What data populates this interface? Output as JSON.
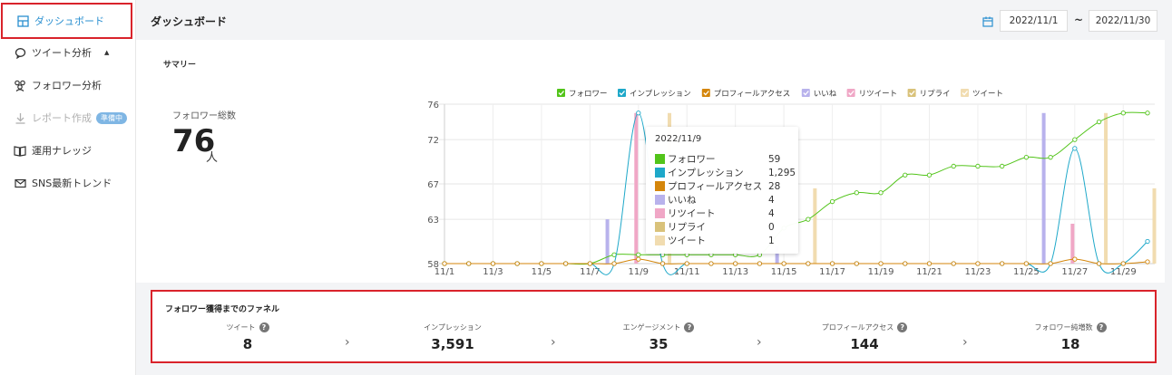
{
  "sidebar": {
    "items": [
      {
        "label": "ダッシュボード",
        "icon": "dashboard-icon"
      },
      {
        "label": "ツイート分析",
        "icon": "speech-bubble-icon"
      },
      {
        "label": "フォロワー分析",
        "icon": "users-icon"
      },
      {
        "label": "レポート作成",
        "icon": "download-icon",
        "badge": "準備中"
      },
      {
        "label": "運用ナレッジ",
        "icon": "book-icon"
      },
      {
        "label": "SNS最新トレンド",
        "icon": "mail-icon"
      }
    ]
  },
  "header": {
    "title": "ダッシュボード",
    "date_from": "2022/11/1",
    "date_sep": "~",
    "date_to": "2022/11/30"
  },
  "summary": {
    "title": "サマリー",
    "follower_label": "フォロワー総数",
    "follower_value": "76",
    "follower_unit": "人"
  },
  "tooltip": {
    "date": "2022/11/9",
    "rows": [
      {
        "label": "フォロワー",
        "value": "59",
        "color": "#52c41a"
      },
      {
        "label": "インプレッション",
        "value": "1,295",
        "color": "#1ea8c9"
      },
      {
        "label": "プロフィールアクセス",
        "value": "28",
        "color": "#d4860b"
      },
      {
        "label": "いいね",
        "value": "4",
        "color": "#b8b2ec"
      },
      {
        "label": "リツイート",
        "value": "4",
        "color": "#f0a7c6"
      },
      {
        "label": "リプライ",
        "value": "0",
        "color": "#d9c27a"
      },
      {
        "label": "ツイート",
        "value": "1",
        "color": "#f1dcb0"
      }
    ]
  },
  "funnel": {
    "title": "フォロワー獲得までのファネル",
    "items": [
      {
        "label": "ツイート",
        "value": "8"
      },
      {
        "label": "インプレッション",
        "value": "3,591"
      },
      {
        "label": "エンゲージメント",
        "value": "35"
      },
      {
        "label": "プロフィールアクセス",
        "value": "144"
      },
      {
        "label": "フォロワー純増数",
        "value": "18"
      }
    ]
  },
  "chart_data": {
    "type": "line",
    "x": [
      "11/1",
      "11/2",
      "11/3",
      "11/4",
      "11/5",
      "11/6",
      "11/7",
      "11/8",
      "11/9",
      "11/10",
      "11/11",
      "11/12",
      "11/13",
      "11/14",
      "11/15",
      "11/16",
      "11/17",
      "11/18",
      "11/19",
      "11/20",
      "11/21",
      "11/22",
      "11/23",
      "11/24",
      "11/25",
      "11/26",
      "11/27",
      "11/28",
      "11/29",
      "11/30"
    ],
    "x_tick_labels": [
      "11/1",
      "11/3",
      "11/5",
      "11/7",
      "11/9",
      "11/11",
      "11/13",
      "11/15",
      "11/17",
      "11/19",
      "11/21",
      "11/23",
      "11/25",
      "11/27",
      "11/29"
    ],
    "y_ticks": [
      58,
      63,
      67,
      72,
      76
    ],
    "ylim": [
      58,
      76
    ],
    "legend_position": "top",
    "grid": true,
    "series": [
      {
        "name": "フォロワー",
        "kind": "line",
        "color": "#52c41a",
        "values": [
          58,
          58,
          58,
          58,
          58,
          58,
          58,
          59,
          59,
          59,
          59,
          59,
          59,
          59,
          62,
          63,
          65,
          66,
          66,
          68,
          68,
          69,
          69,
          69,
          70,
          70,
          72,
          74,
          75,
          75
        ]
      },
      {
        "name": "インプレッション",
        "kind": "line",
        "color": "#1ea8c9",
        "values": [
          58,
          58,
          58,
          58,
          58,
          58,
          58,
          58,
          75,
          58,
          58,
          58,
          58,
          58,
          58,
          58,
          58,
          58,
          58,
          58,
          58,
          58,
          58,
          58,
          58,
          58,
          71,
          58,
          58,
          60.5
        ]
      },
      {
        "name": "プロフィールアクセス",
        "kind": "line",
        "color": "#d4860b",
        "values": [
          58,
          58,
          58,
          58,
          58,
          58,
          58,
          58,
          58.5,
          58,
          58,
          58,
          58,
          58,
          58,
          58,
          58,
          58,
          58,
          58,
          58,
          58,
          58,
          58,
          58,
          58,
          58.5,
          58,
          58,
          58.2
        ]
      },
      {
        "name": "いいね",
        "kind": "bar",
        "color": "#b8b2ec",
        "values": [
          58,
          58,
          58,
          58,
          58,
          58,
          58,
          63,
          58,
          58,
          58,
          58,
          58,
          58,
          60,
          58,
          58,
          58,
          58,
          58,
          58,
          58,
          58,
          58,
          58,
          75,
          58,
          58,
          58,
          58
        ]
      },
      {
        "name": "リツイート",
        "kind": "bar",
        "color": "#f0a7c6",
        "values": [
          58,
          58,
          58,
          58,
          58,
          58,
          58,
          58,
          75,
          58,
          58,
          58,
          58,
          58,
          58,
          58,
          58,
          58,
          58,
          58,
          58,
          58,
          58,
          58,
          58,
          58,
          62.5,
          58,
          58,
          58
        ]
      },
      {
        "name": "リプライ",
        "kind": "bar",
        "color": "#d9c27a",
        "values": [
          58,
          58,
          58,
          58,
          58,
          58,
          58,
          58,
          58,
          58,
          58,
          58,
          58,
          58,
          58,
          58,
          58,
          58,
          58,
          58,
          58,
          58,
          58,
          58,
          58,
          58,
          58,
          58,
          58,
          58
        ]
      },
      {
        "name": "ツイート",
        "kind": "bar",
        "color": "#f1dcb0",
        "values": [
          58,
          58,
          58,
          58,
          58,
          58,
          58,
          58,
          58,
          75,
          58,
          58,
          58,
          58,
          58,
          66.5,
          58,
          58,
          58,
          58,
          58,
          58,
          58,
          58,
          58,
          58,
          58,
          75,
          58,
          66.5
        ]
      }
    ]
  }
}
